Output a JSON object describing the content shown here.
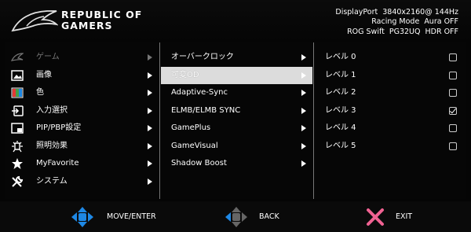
{
  "header": {
    "brand_line1": "REPUBLIC OF",
    "brand_line2": "GAMERS",
    "input": "DisplayPort",
    "resolution": "3840x2160@ 144Hz",
    "racing_mode": "Racing Mode",
    "aura": "Aura OFF",
    "model_brand": "ROG Swift",
    "model": "PG32UQ",
    "hdr": "HDR OFF"
  },
  "main_menu": [
    {
      "label": "ゲーム",
      "icon": "rog-eye-icon",
      "dim": true
    },
    {
      "label": "画像",
      "icon": "image-icon"
    },
    {
      "label": "色",
      "icon": "color-icon"
    },
    {
      "label": "入力選択",
      "icon": "input-select-icon"
    },
    {
      "label": "PIP/PBP設定",
      "icon": "pip-icon"
    },
    {
      "label": "照明効果",
      "icon": "lighting-icon"
    },
    {
      "label": "MyFavorite",
      "icon": "star-icon"
    },
    {
      "label": "システム",
      "icon": "wrench-icon"
    }
  ],
  "sub_menu": [
    {
      "label": "オーバークロック"
    },
    {
      "label": "可変OD",
      "selected": true
    },
    {
      "label": "Adaptive-Sync"
    },
    {
      "label": "ELMB/ELMB SYNC"
    },
    {
      "label": "GamePlus"
    },
    {
      "label": "GameVisual"
    },
    {
      "label": "Shadow Boost"
    }
  ],
  "options": [
    {
      "label": "レベル 0",
      "checked": false
    },
    {
      "label": "レベル 1",
      "checked": false
    },
    {
      "label": "レベル 2",
      "checked": false
    },
    {
      "label": "レベル 3",
      "checked": true
    },
    {
      "label": "レベル 4",
      "checked": false
    },
    {
      "label": "レベル 5",
      "checked": false
    }
  ],
  "footer": {
    "move_enter": "MOVE/ENTER",
    "back": "BACK",
    "exit": "EXIT"
  },
  "colors": {
    "accent_blue": "#1e88e5",
    "accent_pink": "#f06292",
    "selected_bg": "#dcdcdc"
  }
}
